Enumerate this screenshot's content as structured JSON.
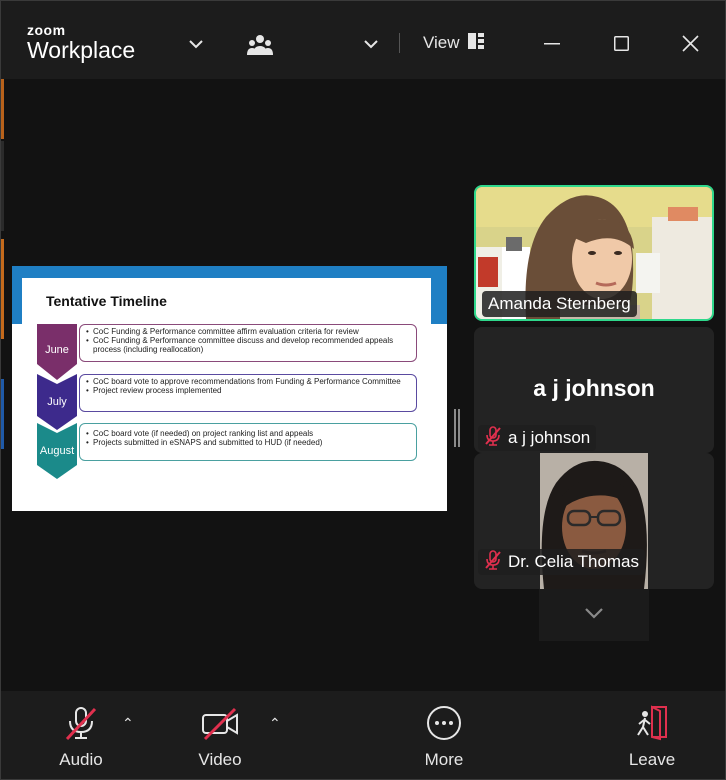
{
  "titlebar": {
    "brand_top": "zoom",
    "brand_bottom": "Workplace",
    "view_label": "View"
  },
  "slide": {
    "title": "Tentative Timeline",
    "rows": [
      {
        "month": "June",
        "color": "#7a2f6a",
        "border": "#8a4a7a",
        "bullets": [
          "CoC Funding & Performance committee affirm evaluation criteria for review",
          "CoC Funding & Performance committee discuss and develop recommended appeals process (including reallocation)"
        ]
      },
      {
        "month": "July",
        "color": "#3d2a8c",
        "border": "#5a4aa0",
        "bullets": [
          "CoC board vote to approve recommendations from Funding & Performance Committee",
          "Project review process implemented"
        ]
      },
      {
        "month": "August",
        "color": "#1b8a8a",
        "border": "#4aa0a0",
        "bullets": [
          "CoC board vote (if needed) on project ranking list and appeals",
          "Projects submitted in eSNAPS and submitted to HUD (if needed)"
        ]
      }
    ]
  },
  "participants": {
    "active_speaker": "Amanda Sternberg",
    "second_big_name": "a j johnson",
    "second_chip": "a j johnson",
    "third_chip": "Dr. Celia Thomas"
  },
  "toolbar": {
    "audio": "Audio",
    "video": "Video",
    "more": "More",
    "leave": "Leave"
  },
  "colors": {
    "active_border": "#2fd88c",
    "muted_red": "#e0304e",
    "leave_red": "#e0304e"
  }
}
